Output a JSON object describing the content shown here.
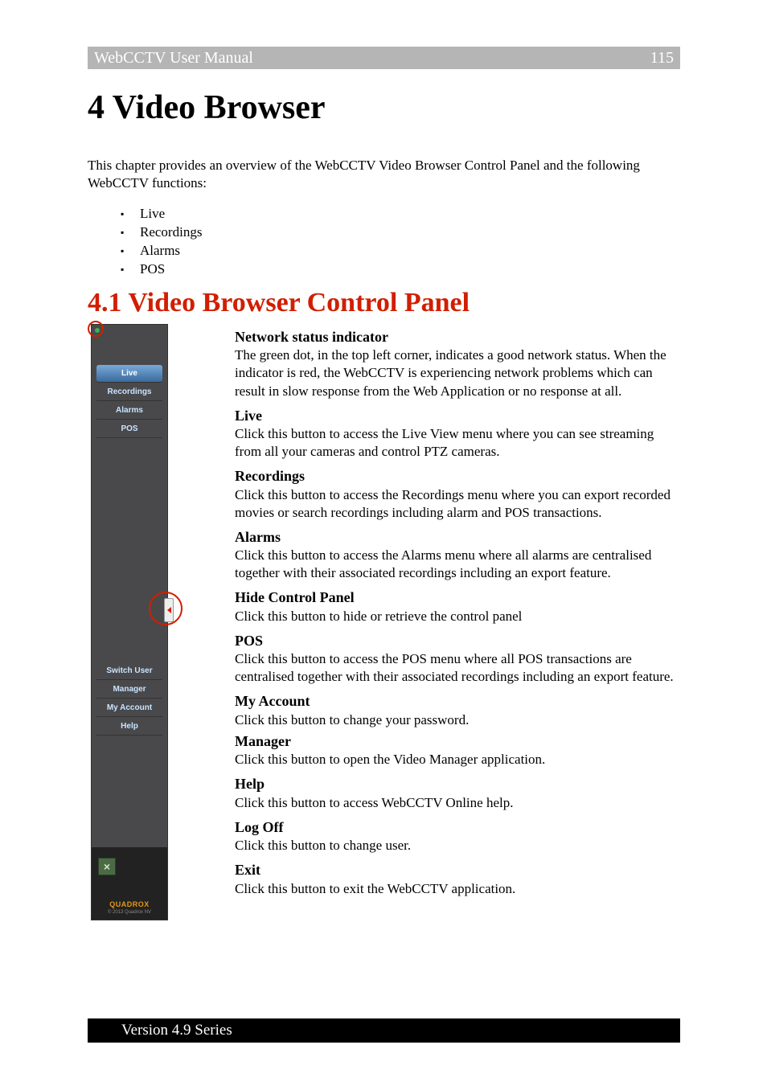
{
  "header": {
    "title": "WebCCTV User Manual",
    "page_number": "115"
  },
  "chapter": {
    "title": "4  Video Browser",
    "intro": "This chapter provides an overview of the WebCCTV Video Browser Control Panel and the following WebCCTV functions:",
    "bullets": [
      "Live",
      "Recordings",
      "Alarms",
      "POS"
    ]
  },
  "section": {
    "title": "4.1 Video Browser Control Panel"
  },
  "control_panel": {
    "nav_top": [
      {
        "label": "Live",
        "active": true
      },
      {
        "label": "Recordings",
        "active": false
      },
      {
        "label": "Alarms",
        "active": false
      },
      {
        "label": "POS",
        "active": false
      }
    ],
    "nav_bottom": [
      {
        "label": "Switch User"
      },
      {
        "label": "Manager"
      },
      {
        "label": "My Account"
      },
      {
        "label": "Help"
      }
    ],
    "logo": "QUADROX",
    "copyright": "© 2013 Quadrox NV"
  },
  "descriptions": [
    {
      "heading": "Network status indicator",
      "body": "The green dot, in the top left corner, indicates a good network status. When the indicator is red, the WebCCTV is experiencing network problems which can result in slow response from the Web Application or no response at all."
    },
    {
      "heading": "Live",
      "body": "Click this button to access the Live View menu where you can see streaming from all your cameras and control PTZ cameras."
    },
    {
      "heading": "Recordings",
      "body": "Click this button to access the Recordings menu where you can export recorded movies or search recordings including alarm and POS transactions."
    },
    {
      "heading": "Alarms",
      "body": "Click this button to access the Alarms menu where all alarms are centralised together with their associated recordings including an export feature."
    },
    {
      "heading": "Hide Control Panel",
      "body": "Click this button to hide or retrieve the control panel"
    },
    {
      "heading": "POS",
      "body": "Click this button to access the POS menu where all POS transactions are centralised together with their associated recordings including an export feature."
    },
    {
      "heading": "My Account",
      "body": "Click this button to change your password."
    },
    {
      "heading": "Manager",
      "body": "Click this button to open the Video Manager application."
    },
    {
      "heading": "Help",
      "body": "Click this button to access WebCCTV Online help."
    },
    {
      "heading": "Log Off",
      "body": "Click this button to change user."
    },
    {
      "heading": "Exit",
      "body": "Click this button to exit the WebCCTV application."
    }
  ],
  "footer": {
    "version": "Version 4.9 Series"
  }
}
